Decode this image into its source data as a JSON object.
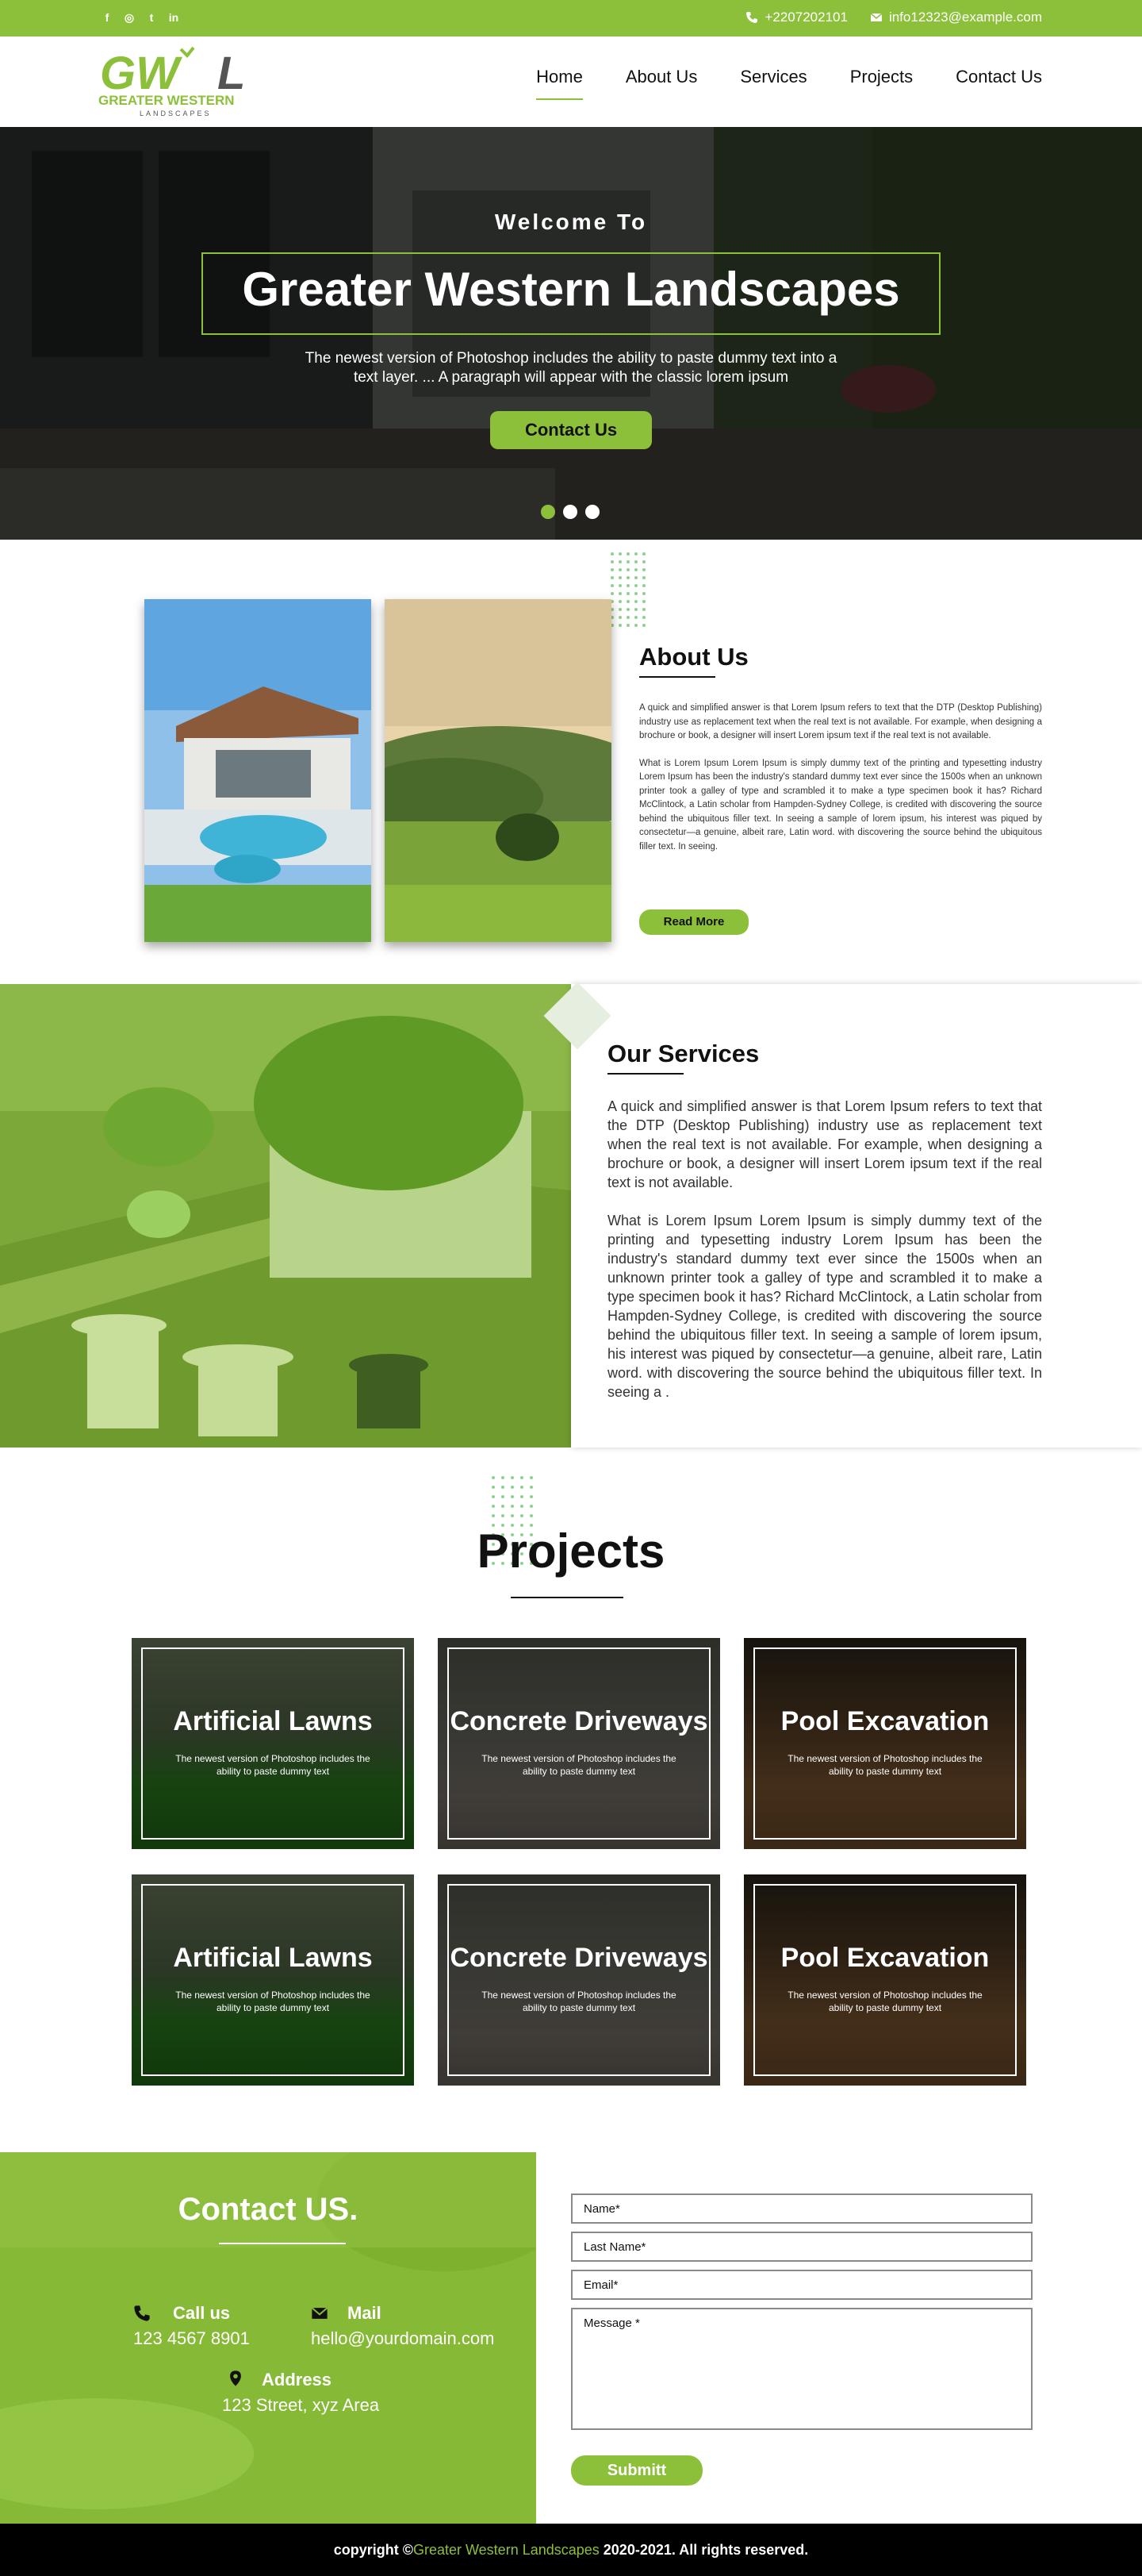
{
  "topbar": {
    "social_icons": [
      "facebook-icon",
      "instagram-icon",
      "twitter-icon",
      "linkedin-icon"
    ],
    "social_glyphs": [
      "f",
      "◎",
      "t",
      "in"
    ],
    "phone": "+2207202101",
    "email": "info12323@example.com"
  },
  "logo": {
    "mark": "GWL",
    "name": "GREATER WESTERN",
    "tagline": "LANDSCAPES"
  },
  "nav": {
    "items": [
      "Home",
      "About Us",
      "Services",
      "Projects",
      "Contact Us"
    ],
    "active": "Home"
  },
  "hero": {
    "welcome": "Welcome To",
    "title": "Greater Western Landscapes",
    "subtitle": "The newest version of Photoshop includes the ability to paste dummy text into a text layer. ... A paragraph will appear with the classic lorem ipsum",
    "button": "Contact Us"
  },
  "about": {
    "title": "About Us",
    "p1": "A quick and simplified answer is that Lorem Ipsum refers to text that the DTP (Desktop Publishing) industry use as replacement text when the real text is not available. For example, when designing a brochure or book, a designer will insert Lorem ipsum text if the real text is not available.",
    "p2": "What is Lorem Ipsum Lorem Ipsum is simply dummy text of the printing and typesetting industry Lorem Ipsum has been the industry's standard dummy text ever since the 1500s when an unknown printer took a galley of type and scrambled it to make a type specimen book it has? Richard McClintock, a Latin scholar from Hampden-Sydney College, is credited with discovering the source behind the ubiquitous filler text. In seeing a sample of lorem ipsum, his interest was piqued by consectetur—a genuine, albeit rare, Latin word. with discovering the source behind the ubiquitous filler text. In seeing.",
    "button": "Read More"
  },
  "services": {
    "title": "Our Services",
    "p1": "A quick and simplified answer is that Lorem Ipsum refers to text that the DTP (Desktop Publishing) industry use as replacement text when the real text is not available. For example, when designing a brochure or book, a designer will insert Lorem ipsum text if the real text is not available.",
    "p2": "What is Lorem Ipsum Lorem Ipsum is simply dummy text of the printing and typesetting industry Lorem Ipsum has been the industry's standard dummy text ever since the 1500s when an unknown printer took a galley of type and scrambled it to make a type specimen book it has? Richard McClintock, a Latin scholar from Hampden-Sydney College, is credited with discovering the source behind the ubiquitous filler text. In seeing a sample of lorem ipsum, his interest was piqued by consectetur—a genuine, albeit rare, Latin word. with discovering the source behind the ubiquitous filler text. In seeing a ."
  },
  "projects": {
    "title": "Projects",
    "cards": [
      {
        "title": "Artificial Lawns",
        "text": "The newest version of Photoshop includes the ability to paste dummy text"
      },
      {
        "title": "Concrete Driveways",
        "text": "The newest version of Photoshop includes the ability to paste dummy text"
      },
      {
        "title": "Pool Excavation",
        "text": "The newest version of Photoshop includes the ability to paste dummy text"
      },
      {
        "title": "Artificial Lawns",
        "text": "The newest version of Photoshop includes the ability to paste dummy text"
      },
      {
        "title": "Concrete Driveways",
        "text": "The newest version of Photoshop includes the ability to paste dummy text"
      },
      {
        "title": "Pool Excavation",
        "text": "The newest version of Photoshop includes the ability to paste dummy text"
      }
    ]
  },
  "contact": {
    "title": "Contact US.",
    "call_label": "Call us",
    "call_value": "123 4567 8901",
    "mail_label": "Mail",
    "mail_value": "hello@yourdomain.com",
    "address_label": "Address",
    "address_value": "123 Street, xyz Area",
    "form": {
      "name_placeholder": "Name*",
      "lastname_placeholder": "Last Name*",
      "email_placeholder": "Email*",
      "message_placeholder": "Message *",
      "submit": "Submitt"
    }
  },
  "footer": {
    "prefix": "copyright ©",
    "brand": "Greater Western Landscapes",
    "suffix": " 2020-2021. All rights reserved."
  },
  "colors": {
    "accent": "#8dc03a",
    "dark": "#111111",
    "footer_bg": "#000000"
  }
}
